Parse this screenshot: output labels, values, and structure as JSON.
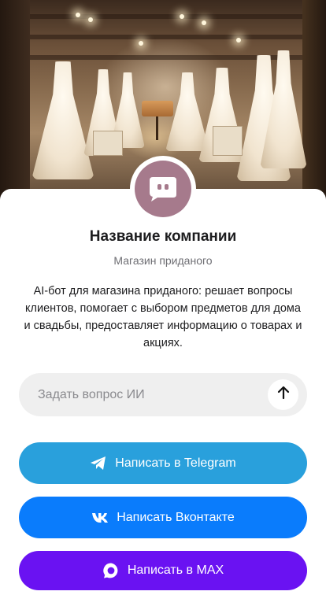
{
  "hero": {
    "image": "bridal-boutique-interior"
  },
  "company": {
    "avatar_icon": "chat-bot-icon",
    "avatar_color": "#a67a8c",
    "name": "Название компании",
    "subtitle": "Магазин приданого",
    "description": "AI-бот для магазина приданого: решает вопросы клиентов, помогает с выбором предметов для дома и свадьбы, предоставляет информацию о товарах и акциях."
  },
  "ask": {
    "placeholder": "Задать вопрос ИИ",
    "value": "",
    "send_icon": "arrow-up-icon"
  },
  "actions": {
    "telegram": {
      "label": "Написать в Telegram",
      "icon": "telegram-icon",
      "color": "#29a0dc"
    },
    "vk": {
      "label": "Написать Вконтакте",
      "icon": "vk-icon",
      "color": "#0a7cfc"
    },
    "max": {
      "label": "Написать в MAX",
      "icon": "max-icon",
      "color": "#6a12f2"
    }
  }
}
